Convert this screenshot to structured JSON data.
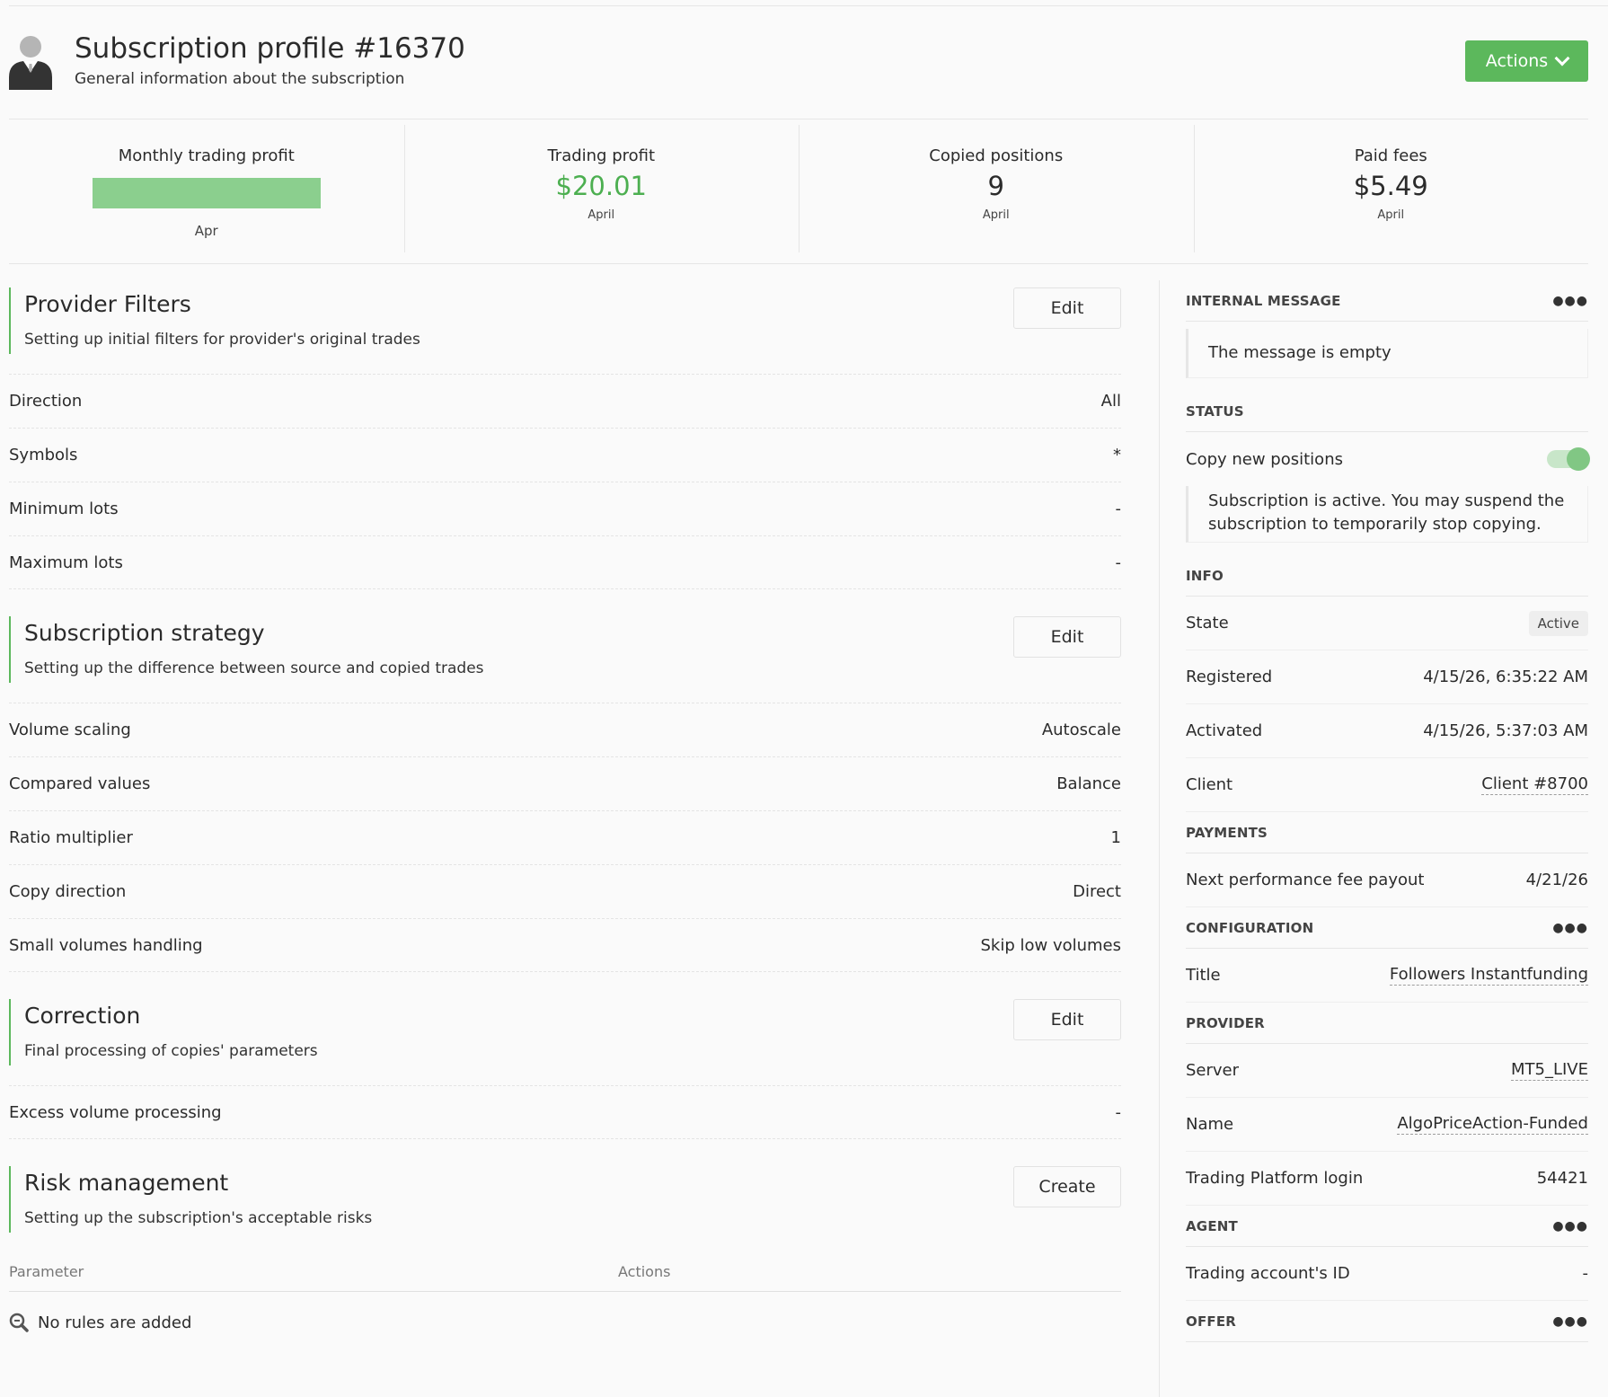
{
  "header": {
    "title": "Subscription profile #16370",
    "subtitle": "General information about the subscription",
    "actions_label": "Actions"
  },
  "stats": {
    "monthly": {
      "label": "Monthly trading profit",
      "category": "Apr",
      "fill_percent": 100
    },
    "trading_profit": {
      "label": "Trading profit",
      "value": "$20.01",
      "period": "April"
    },
    "copied_positions": {
      "label": "Copied positions",
      "value": "9",
      "period": "April"
    },
    "paid_fees": {
      "label": "Paid fees",
      "value": "$5.49",
      "period": "April"
    }
  },
  "provider_filters": {
    "title": "Provider Filters",
    "desc": "Setting up initial filters for provider's original trades",
    "edit": "Edit",
    "rows": [
      {
        "label": "Direction",
        "value": "All"
      },
      {
        "label": "Symbols",
        "value": "*"
      },
      {
        "label": "Minimum lots",
        "value": "-"
      },
      {
        "label": "Maximum lots",
        "value": "-"
      }
    ]
  },
  "strategy": {
    "title": "Subscription strategy",
    "desc": "Setting up the difference between source and copied trades",
    "edit": "Edit",
    "rows": [
      {
        "label": "Volume scaling",
        "value": "Autoscale"
      },
      {
        "label": "Compared values",
        "value": "Balance"
      },
      {
        "label": "Ratio multiplier",
        "value": "1"
      },
      {
        "label": "Copy direction",
        "value": "Direct"
      },
      {
        "label": "Small volumes handling",
        "value": "Skip low volumes"
      }
    ]
  },
  "correction": {
    "title": "Correction",
    "desc": "Final processing of copies' parameters",
    "edit": "Edit",
    "rows": [
      {
        "label": "Excess volume processing",
        "value": "-"
      }
    ]
  },
  "risk": {
    "title": "Risk management",
    "desc": "Setting up the subscription's acceptable risks",
    "create": "Create",
    "col_parameter": "Parameter",
    "col_actions": "Actions",
    "empty": "No rules are added"
  },
  "sidebar": {
    "internal_message": {
      "heading": "INTERNAL MESSAGE",
      "text": "The message is empty"
    },
    "status": {
      "heading": "STATUS",
      "copy_label": "Copy new positions",
      "copy_enabled": true,
      "note": "Subscription is active. You may suspend the subscription to temporarily stop copying."
    },
    "info": {
      "heading": "INFO",
      "state_label": "State",
      "state_value": "Active",
      "registered_label": "Registered",
      "registered_value": "4/15/26, 6:35:22 AM",
      "activated_label": "Activated",
      "activated_value": "4/15/26, 5:37:03 AM",
      "client_label": "Client",
      "client_value": "Client #8700"
    },
    "payments": {
      "heading": "PAYMENTS",
      "next_label": "Next performance fee payout",
      "next_value": "4/21/26"
    },
    "configuration": {
      "heading": "CONFIGURATION",
      "title_label": "Title",
      "title_value": "Followers Instantfunding"
    },
    "provider": {
      "heading": "PROVIDER",
      "server_label": "Server",
      "server_value": "MT5_LIVE",
      "name_label": "Name",
      "name_value": "AlgoPriceAction-Funded",
      "login_label": "Trading Platform login",
      "login_value": "54421"
    },
    "agent": {
      "heading": "AGENT",
      "account_label": "Trading account's ID",
      "account_value": "-"
    },
    "offer": {
      "heading": "OFFER"
    }
  },
  "colors": {
    "accent": "#5cb85c",
    "profit": "#4caf50"
  },
  "icons": {
    "avatar": "user-avatar-icon",
    "more": "more-dots-icon",
    "search": "search-zoom-icon",
    "chevron": "chevron-down-icon"
  }
}
